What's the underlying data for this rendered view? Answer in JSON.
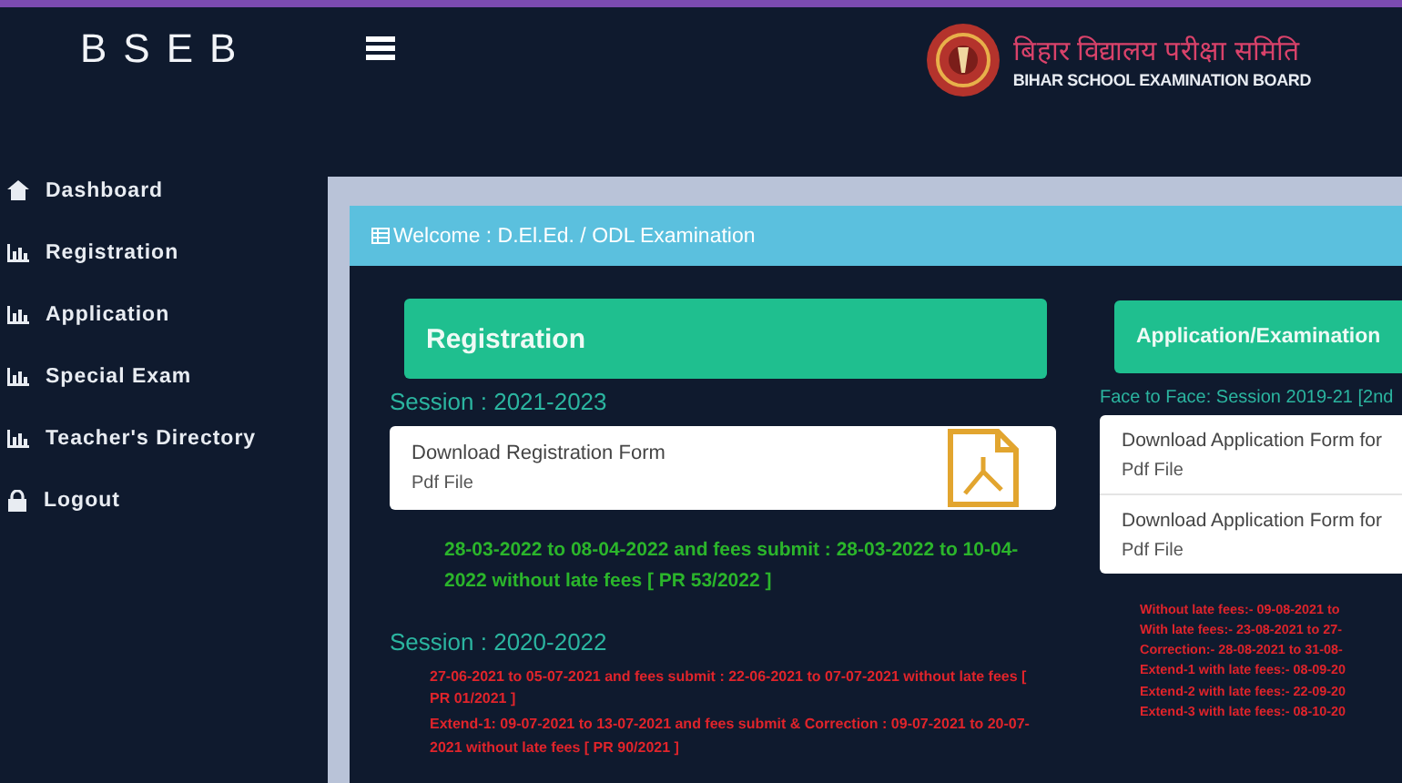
{
  "header": {
    "logo": "BSEB",
    "board_name_hindi": "बिहार विद्यालय परीक्षा समिति",
    "board_name": "BIHAR SCHOOL EXAMINATION BOARD"
  },
  "sidebar": {
    "items": [
      {
        "label": "Dashboard",
        "kind": "home"
      },
      {
        "label": "Registration",
        "kind": "section"
      },
      {
        "label": "Application",
        "kind": "section"
      },
      {
        "label": "Special Exam",
        "kind": "section"
      },
      {
        "label": "Teacher's Directory",
        "kind": "section"
      },
      {
        "label": "Logout",
        "kind": "logout"
      }
    ]
  },
  "panel": {
    "title": "Welcome : D.El.Ed. / ODL Examination",
    "registration": {
      "heading": "Registration",
      "sessions": [
        {
          "title": "Session : 2021-2023",
          "downloads": [
            {
              "label": "Download Registration Form",
              "sub": "Pdf File"
            }
          ],
          "notes": [
            {
              "text": "28-03-2022 to 08-04-2022 and fees submit : 28-03-2022 to 10-04-2022 without late fees [ PR 53/2022 ]",
              "color": "#2bb52b"
            }
          ]
        },
        {
          "title": "Session : 2020-2022",
          "notes": [
            {
              "text": "27-06-2021 to 05-07-2021 and fees submit : 22-06-2021 to 07-07-2021 without late fees [ PR 01/2021 ]",
              "color": "#e0242b"
            },
            {
              "text": "Extend-1: 09-07-2021 to 13-07-2021 and fees submit & Correction : 09-07-2021 to 20-07-2021 without late fees [ PR 90/2021 ]",
              "color": "#e0242b"
            }
          ]
        }
      ]
    },
    "application": {
      "heading": "Application/Examination",
      "session": "Face to Face: Session 2019-21 [2nd",
      "downloads": [
        {
          "label": "Download Application Form for",
          "sub": "Pdf File"
        },
        {
          "label": "Download Application Form for",
          "sub": "Pdf File"
        }
      ],
      "notes": [
        "Without late fees:- 09-08-2021 to",
        "With late fees:- 23-08-2021 to 27-",
        "Correction:- 28-08-2021 to 31-08-",
        "Extend-1 with late fees:- 08-09-20",
        "Extend-2 with late fees:- 22-09-20",
        "Extend-3 with late fees:- 08-10-20"
      ]
    }
  }
}
